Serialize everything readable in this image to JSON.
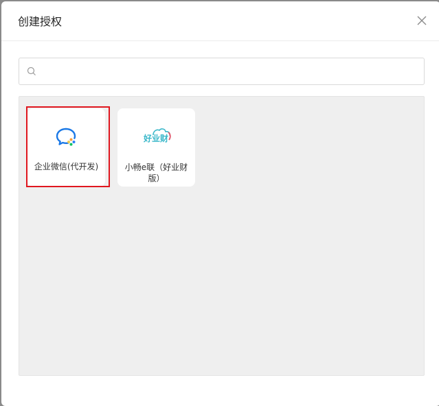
{
  "dialog": {
    "title": "创建授权",
    "close_icon": "close-icon"
  },
  "search": {
    "value": "",
    "placeholder": "",
    "icon": "search-icon"
  },
  "apps": [
    {
      "name": "企业微信(代开发)",
      "icon": "wecom-chat-icon",
      "highlighted": true,
      "highlight_color": "#e0161e"
    },
    {
      "name": "小畅e联（好业财版）",
      "icon": "haoyecai-logo-icon",
      "logo_text": "好业财"
    }
  ],
  "colors": {
    "panel_bg": "#efefef",
    "highlight": "#e0161e",
    "wecom_blue": "#1a78e6",
    "logo_teal": "#39b7c9"
  }
}
